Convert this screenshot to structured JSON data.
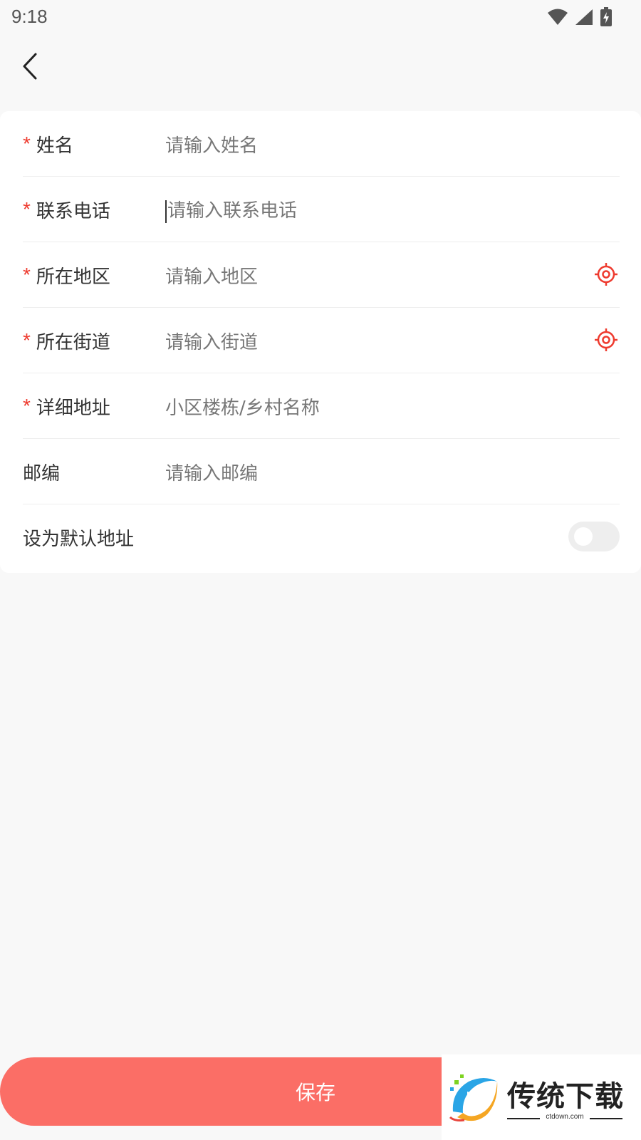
{
  "status_bar": {
    "time": "9:18",
    "icons": [
      "wifi-icon",
      "signal-icon",
      "battery-charging-icon"
    ]
  },
  "header": {
    "back_icon": "chevron-left-icon"
  },
  "form": {
    "fields": [
      {
        "required": true,
        "required_mark": "*",
        "label": "姓名",
        "placeholder": "请输入姓名"
      },
      {
        "required": true,
        "required_mark": "*",
        "label": "联系电话",
        "placeholder": "请输入联系电话",
        "focused": true
      },
      {
        "required": true,
        "required_mark": "*",
        "label": "所在地区",
        "placeholder": "请输入地区",
        "icon": "locate-icon"
      },
      {
        "required": true,
        "required_mark": "*",
        "label": "所在街道",
        "placeholder": "请输入街道",
        "icon": "locate-icon"
      },
      {
        "required": true,
        "required_mark": "*",
        "label": "详细地址",
        "placeholder": "小区楼栋/乡村名称"
      },
      {
        "required": false,
        "label": "邮编",
        "placeholder": "请输入邮编"
      }
    ],
    "default_toggle": {
      "label": "设为默认地址",
      "on": false
    }
  },
  "save_button": {
    "label": "保存"
  },
  "watermark": {
    "text": "传统下载",
    "subtext": "ctdown.com"
  },
  "colors": {
    "accent": "#ee3b2f",
    "button": "#fb6e66",
    "background": "#f8f8f8",
    "card": "#ffffff"
  }
}
